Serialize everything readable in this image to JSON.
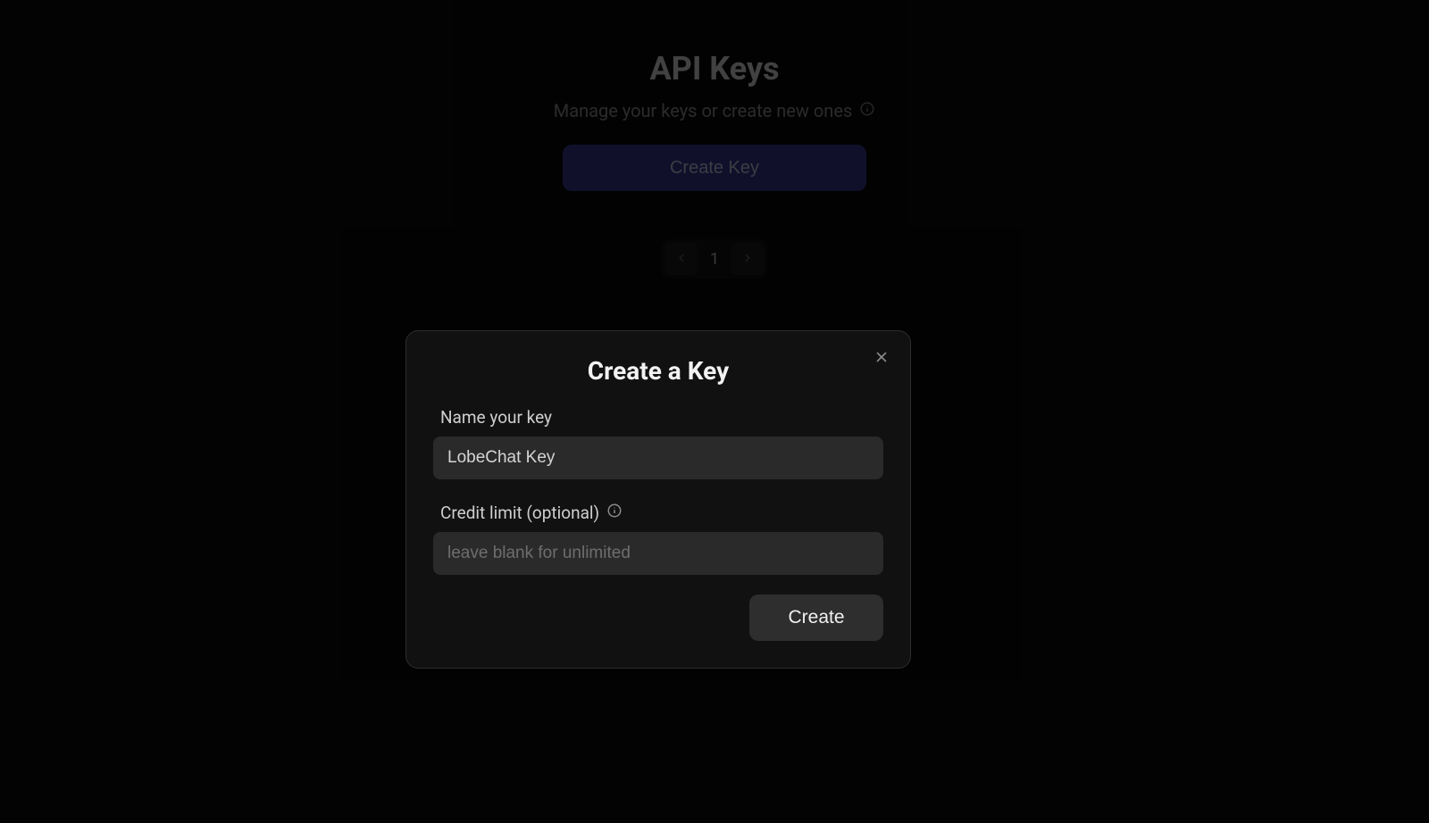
{
  "page": {
    "title": "API Keys",
    "subtitle": "Manage your keys or create new ones",
    "create_key_label": "Create Key"
  },
  "pagination": {
    "current_page": "1"
  },
  "modal": {
    "title": "Create a Key",
    "name_label": "Name your key",
    "name_value": "LobeChat Key",
    "credit_label": "Credit limit (optional)",
    "credit_placeholder": "leave blank for unlimited",
    "credit_value": "",
    "create_label": "Create"
  }
}
